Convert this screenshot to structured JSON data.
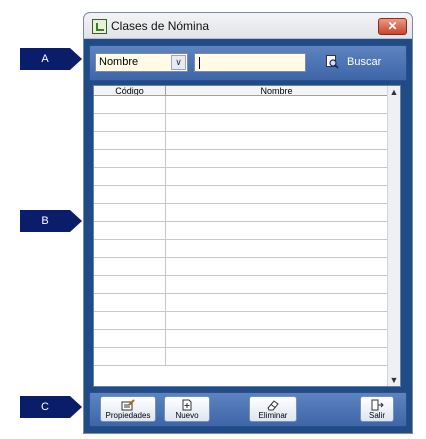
{
  "window": {
    "title": "Clases de Nómina",
    "close_label": "✕"
  },
  "callouts": {
    "a": "A",
    "b": "B",
    "c": "C"
  },
  "search": {
    "field_value": "Nombre",
    "field_arrow": "∨",
    "input_value": "",
    "button_label": "Buscar",
    "button_icon": "search-icon"
  },
  "grid": {
    "columns": [
      "Código",
      "Nombre"
    ],
    "rows": 15,
    "scroll_up": "▲",
    "scroll_down": "▼"
  },
  "toolbar": {
    "properties_label": "Propiedades",
    "new_label": "Nuevo",
    "delete_label": "Eliminar",
    "exit_label": "Salir"
  }
}
